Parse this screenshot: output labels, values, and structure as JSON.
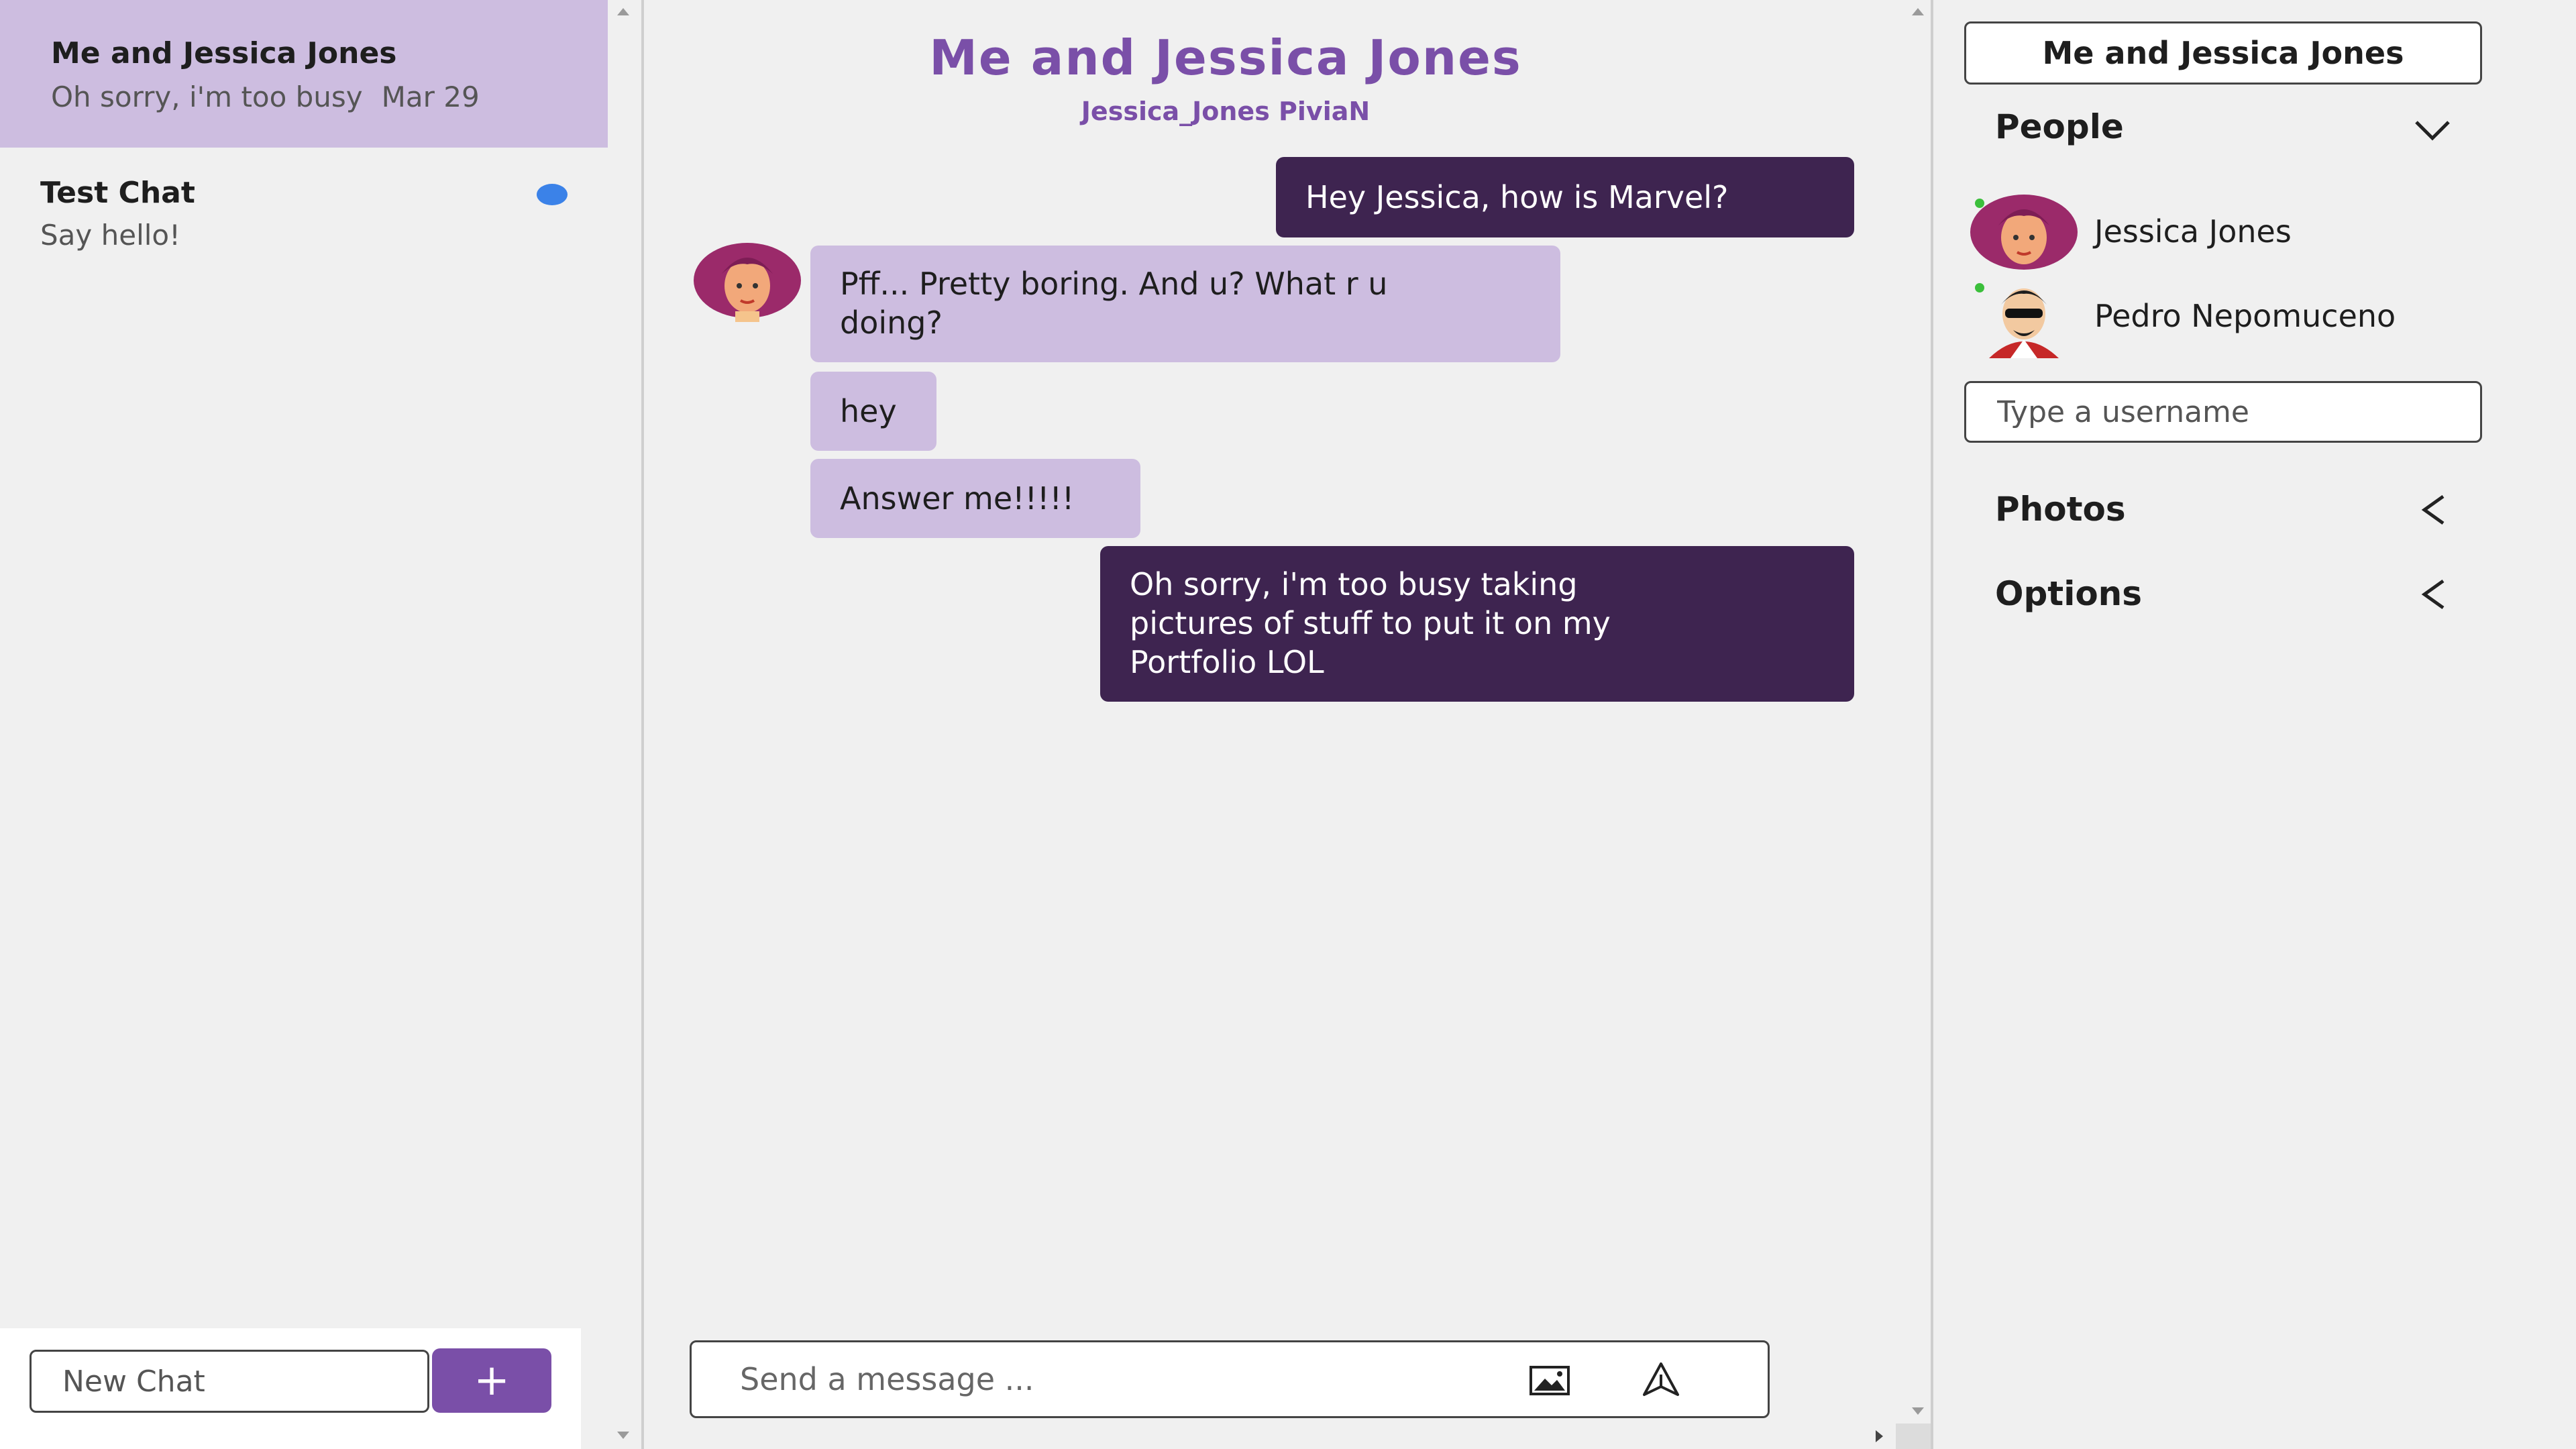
{
  "left_panel": {
    "chats": [
      {
        "title": "Me and Jessica Jones",
        "preview": "Oh sorry, i'm too busy",
        "date": "Mar 29",
        "active": true,
        "unread": false
      },
      {
        "title": "Test Chat",
        "preview": "Say hello!",
        "date": "",
        "active": false,
        "unread": true
      }
    ],
    "new_chat": {
      "placeholder": "New Chat",
      "add_label": "+"
    }
  },
  "chat": {
    "title": "Me and Jessica Jones",
    "members": "Jessica_Jones PiviaN",
    "messages": [
      {
        "author": "me",
        "text": "Hey Jessica, how is Marvel?"
      },
      {
        "author": "Jessica Jones",
        "text_lines": [
          "Pff... Pretty boring. And u? What r u",
          "doing?"
        ]
      },
      {
        "author": "Jessica Jones",
        "text": "hey"
      },
      {
        "author": "Jessica Jones",
        "text": "Answer me!!!!!"
      },
      {
        "author": "me",
        "text_lines": [
          "Oh sorry, i'm too busy taking",
          "pictures of stuff to put it on my",
          "Portfolio LOL"
        ]
      }
    ],
    "composer": {
      "placeholder": "Send a message ...",
      "attach_icon": "image-icon",
      "send_icon": "send-icon"
    }
  },
  "settings_panel": {
    "chat_title_value": "Me and Jessica Jones",
    "people": {
      "label": "People",
      "expanded": true,
      "members": [
        {
          "name": "Jessica Jones",
          "online": true,
          "avatar": "woman-avatar"
        },
        {
          "name": "Pedro Nepomuceno",
          "online": true,
          "avatar": "man-avatar"
        }
      ],
      "add_placeholder": "Type a username"
    },
    "photos": {
      "label": "Photos",
      "expanded": false
    },
    "options": {
      "label": "Options",
      "expanded": false
    }
  },
  "colors": {
    "accent": "#7a4fa8",
    "bubble_mine": "#3e2450",
    "bubble_theirs": "#cdbde0",
    "active_chat": "#cdbde0",
    "unread_dot": "#3b82e8",
    "online": "#3bbf3b"
  }
}
